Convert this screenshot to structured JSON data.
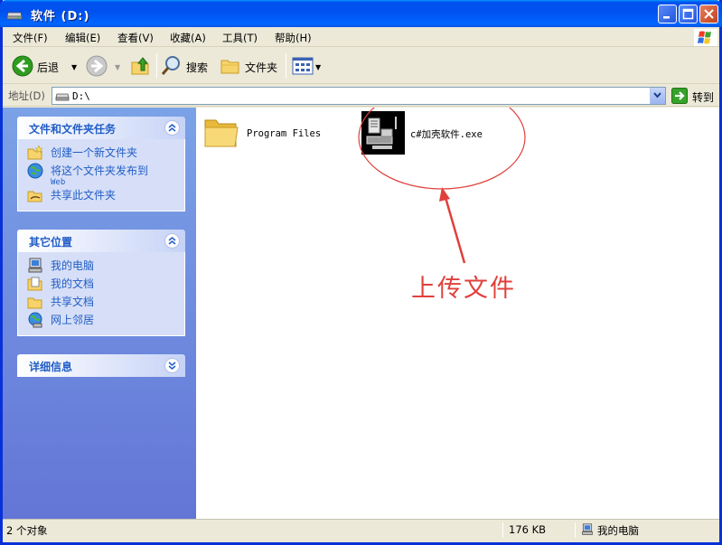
{
  "window": {
    "title": "软件 (D:)",
    "icon": "drive-icon"
  },
  "menu": {
    "items": [
      "文件(F)",
      "编辑(E)",
      "查看(V)",
      "收藏(A)",
      "工具(T)",
      "帮助(H)"
    ]
  },
  "toolbar": {
    "back_label": "后退",
    "search_label": "搜索",
    "folders_label": "文件夹"
  },
  "address": {
    "label": "地址(D)",
    "value": "D:\\",
    "go_label": "转到"
  },
  "tasks_panel": {
    "title": "文件和文件夹任务",
    "items": [
      {
        "label": "创建一个新文件夹",
        "icon": "new-folder-icon"
      },
      {
        "label": "将这个文件夹发布到",
        "sub": "Web",
        "icon": "publish-web-icon"
      },
      {
        "label": "共享此文件夹",
        "icon": "share-folder-icon"
      }
    ]
  },
  "places_panel": {
    "title": "其它位置",
    "items": [
      {
        "label": "我的电脑",
        "icon": "my-computer-icon"
      },
      {
        "label": "我的文档",
        "icon": "my-documents-icon"
      },
      {
        "label": "共享文档",
        "icon": "shared-documents-icon"
      },
      {
        "label": "网上邻居",
        "icon": "network-places-icon"
      }
    ]
  },
  "details_panel": {
    "title": "详细信息"
  },
  "files": [
    {
      "name": "Program Files",
      "icon": "folder-icon"
    },
    {
      "name": "c#加壳软件.exe",
      "icon": "installer-exe-icon"
    }
  ],
  "annotation": {
    "text": "上传文件",
    "color": "#e0403c"
  },
  "status": {
    "objects": "2 个对象",
    "size": "176 KB",
    "location": "我的电脑"
  },
  "colors": {
    "title_blue": "#0053ee",
    "task_pane": "#7ba2e7",
    "link_blue": "#215dc6"
  }
}
